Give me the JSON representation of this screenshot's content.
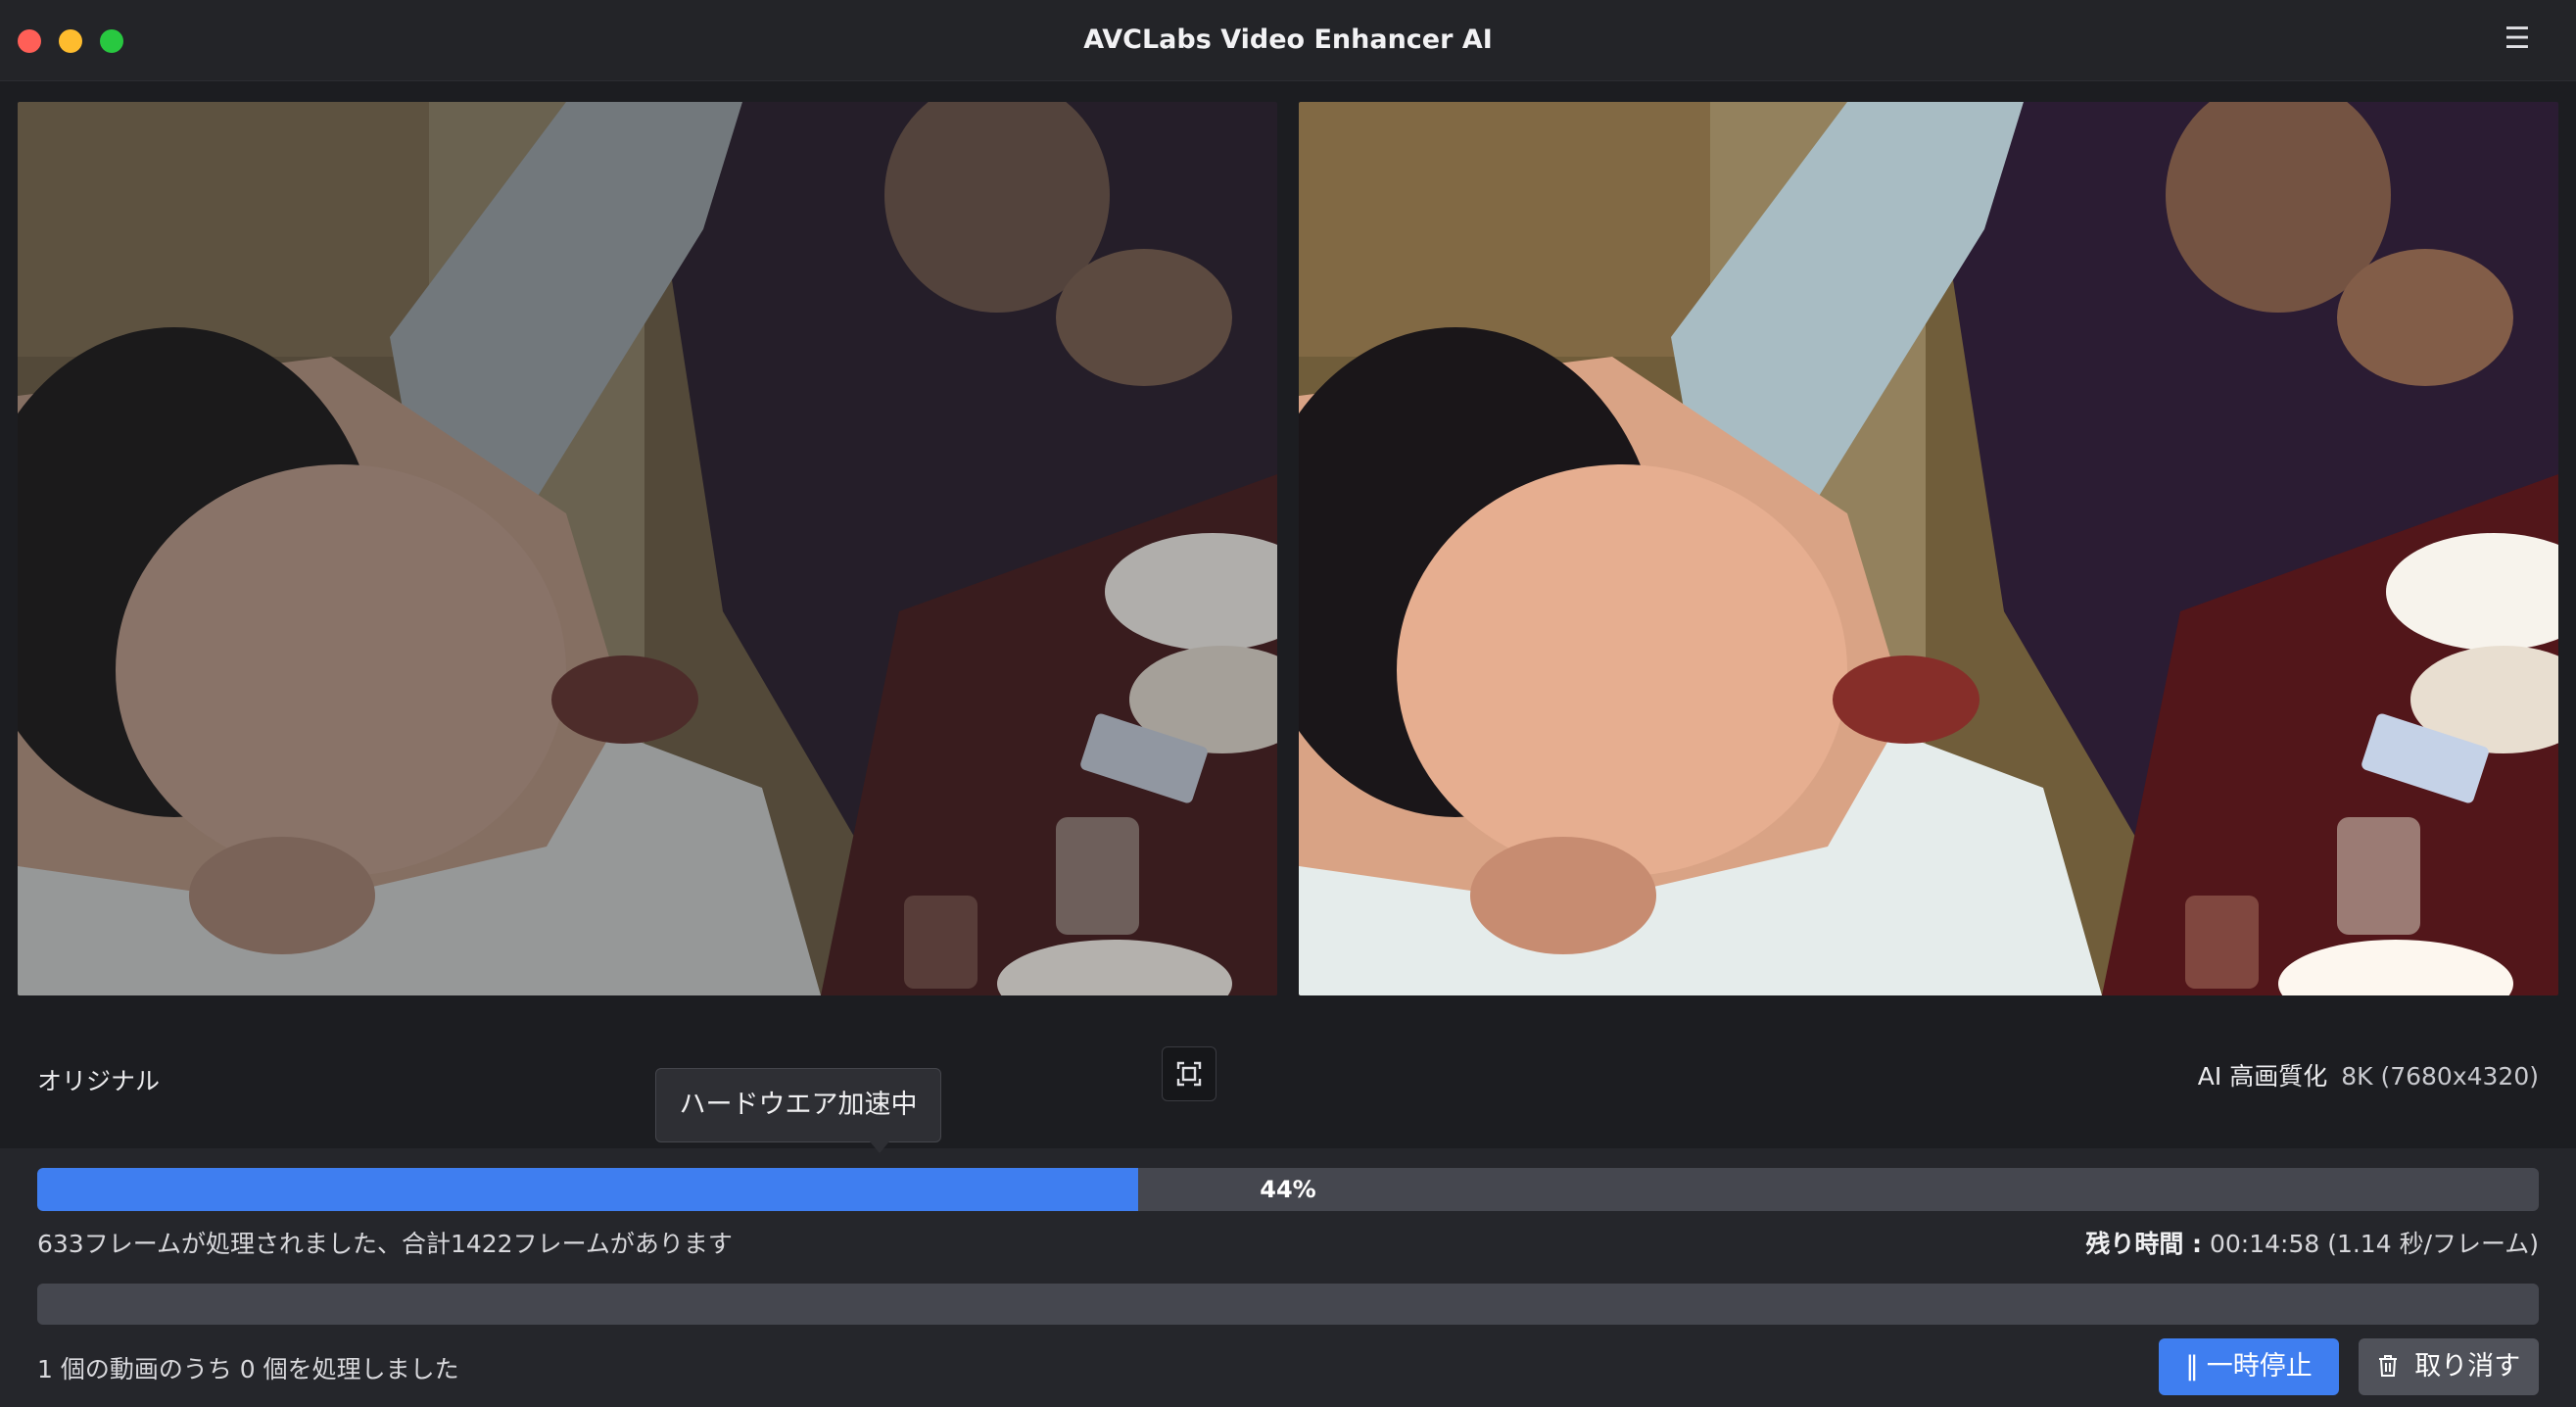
{
  "window": {
    "title": "AVCLabs Video Enhancer AI",
    "menu_icon": "hamburger-icon"
  },
  "preview": {
    "original_label": "オリジナル",
    "ai_label": "AI 高画質化",
    "ai_resolution": "8K (7680x4320)",
    "compare_icon": "fullscreen-compare-icon"
  },
  "tooltip": {
    "text": "ハードウエア加速中"
  },
  "progress": {
    "percent": 44,
    "percent_label": "44%",
    "frames_text": "633フレームが処理されました、合計1422フレームがあります",
    "remaining_label": "残り時間 :",
    "remaining_value": " 00:14:58 (1.14 秒/フレーム)"
  },
  "batch": {
    "count_text": "1 個の動画のうち 0 個を処理しました",
    "progress_percent": 0
  },
  "buttons": {
    "pause_icon": "pause-icon",
    "pause_label": "一時停止",
    "cancel_icon": "trash-icon",
    "cancel_label": "取り消す"
  },
  "colors": {
    "accent": "#3f7ef0",
    "background": "#1c1d21",
    "panel": "#25262b"
  }
}
